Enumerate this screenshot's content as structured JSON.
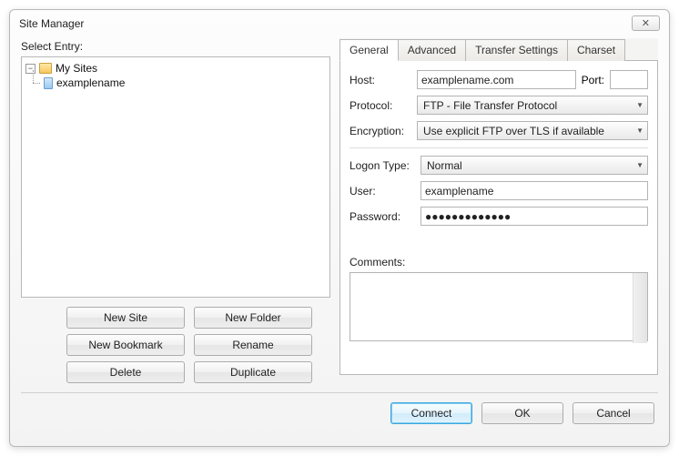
{
  "window": {
    "title": "Site Manager",
    "close_glyph": "✕"
  },
  "left": {
    "select_entry": "Select Entry:",
    "root": "My Sites",
    "site": "examplename",
    "buttons": {
      "new_site": "New Site",
      "new_folder": "New Folder",
      "new_bookmark": "New Bookmark",
      "rename": "Rename",
      "delete": "Delete",
      "duplicate": "Duplicate"
    }
  },
  "tabs": {
    "general": "General",
    "advanced": "Advanced",
    "transfer": "Transfer Settings",
    "charset": "Charset"
  },
  "form": {
    "host_label": "Host:",
    "host_value": "examplename.com",
    "port_label": "Port:",
    "port_value": "",
    "protocol_label": "Protocol:",
    "protocol_value": "FTP - File Transfer Protocol",
    "encryption_label": "Encryption:",
    "encryption_value": "Use explicit FTP over TLS if available",
    "logon_label": "Logon Type:",
    "logon_value": "Normal",
    "user_label": "User:",
    "user_value": "examplename",
    "password_label": "Password:",
    "password_value": "●●●●●●●●●●●●●",
    "comments_label": "Comments:",
    "comments_value": ""
  },
  "footer": {
    "connect": "Connect",
    "ok": "OK",
    "cancel": "Cancel"
  }
}
